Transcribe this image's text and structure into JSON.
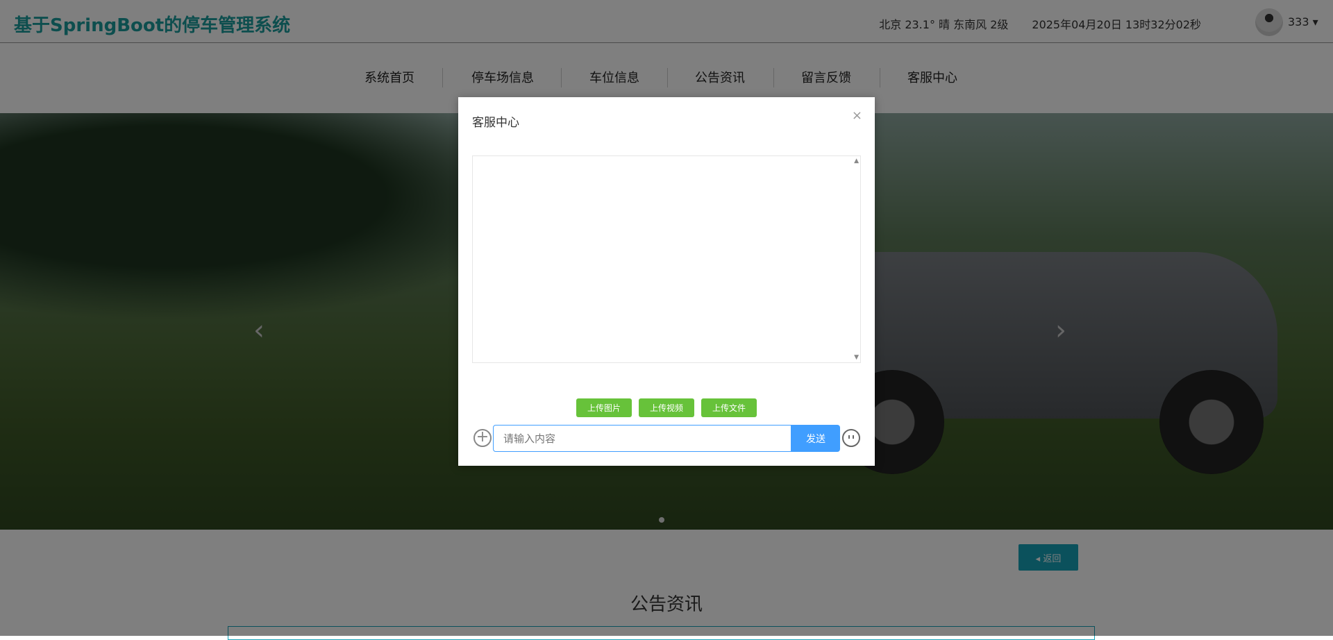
{
  "header": {
    "title": "基于SpringBoot的停车管理系统",
    "weather": "北京  23.1°  晴  东南风  2级",
    "datetime": "2025年04月20日 13时32分02秒",
    "user": "333 ▾"
  },
  "nav": [
    "系统首页",
    "停车场信息",
    "车位信息",
    "公告资讯",
    "留言反馈",
    "客服中心"
  ],
  "carousel": {
    "prev": "‹",
    "next": "›"
  },
  "back_button": "◂ 返回",
  "section_title": "公告资讯",
  "modal": {
    "title": "客服中心",
    "close": "×",
    "upload_buttons": [
      "上传图片",
      "上传视频",
      "上传文件"
    ],
    "input_placeholder": "请输入内容",
    "send": "发送",
    "plus": "+"
  }
}
